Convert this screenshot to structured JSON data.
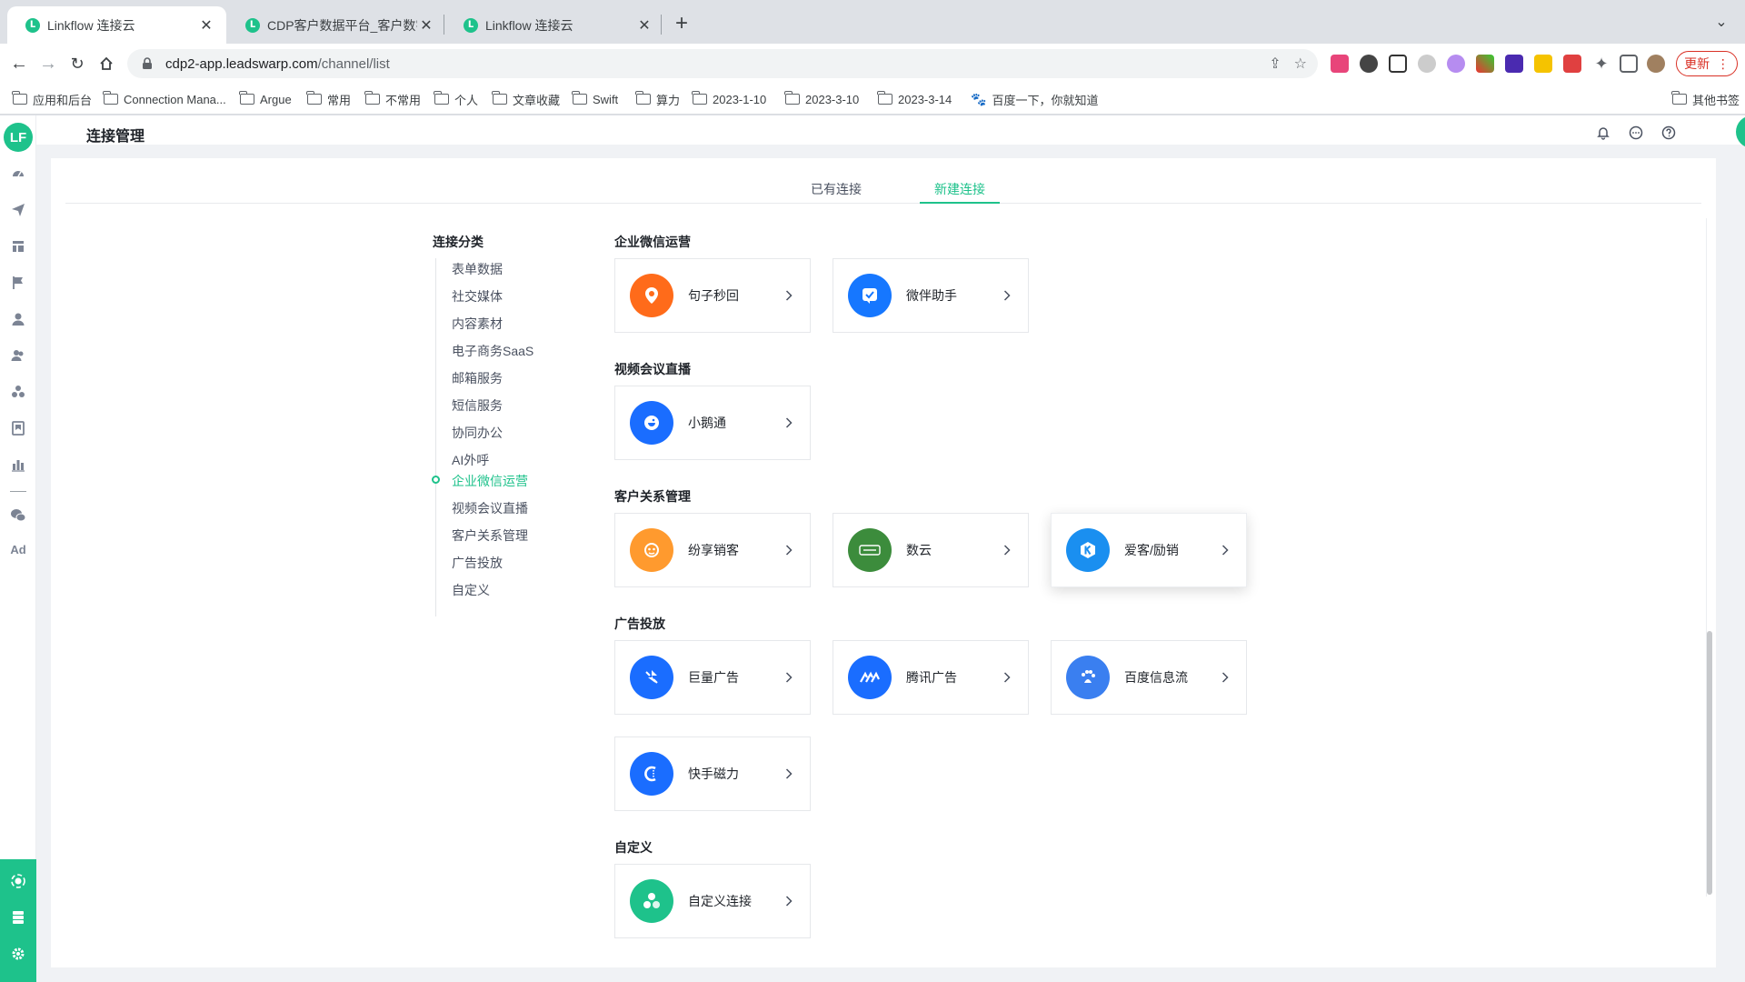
{
  "browser": {
    "tabs": [
      {
        "title": "Linkflow 连接云",
        "favicon": "linkflow-favicon"
      },
      {
        "title": "CDP客户数据平台_客户数字化全",
        "favicon": "linkflow-favicon"
      },
      {
        "title": "Linkflow 连接云",
        "favicon": "linkflow-favicon"
      }
    ],
    "url_host": "cdp2-app.leadswarp.com",
    "url_path": "/channel/list",
    "update_label": "更新",
    "bookmarks": [
      "应用和后台",
      "Connection Mana...",
      "Argue",
      "常用",
      "不常用",
      "个人",
      "文章收藏",
      "Swift",
      "算力",
      "2023-1-10",
      "2023-3-10",
      "2023-3-14",
      "百度一下，你就知道"
    ],
    "other_bookmarks": "其他书签"
  },
  "app": {
    "logo": "LF",
    "page_title": "连接管理",
    "sidebar_ad": "Ad",
    "tabs": [
      "已有连接",
      "新建连接"
    ],
    "active_tab": 1,
    "category_title": "连接分类",
    "categories": [
      "表单数据",
      "社交媒体",
      "内容素材",
      "电子商务SaaS",
      "邮箱服务",
      "短信服务",
      "协同办公",
      "AI外呼",
      "企业微信运营",
      "视频会议直播",
      "客户关系管理",
      "广告投放",
      "自定义"
    ],
    "active_category": 8,
    "sections": [
      {
        "title": "企业微信运营",
        "cards": [
          {
            "name": "句子秒回",
            "icon": "chat-pin-icon",
            "color": "#ff6b1a"
          },
          {
            "name": "微伴助手",
            "icon": "check-bubble-icon",
            "color": "#1677ff"
          }
        ]
      },
      {
        "title": "视频会议直播",
        "cards": [
          {
            "name": "小鹅通",
            "icon": "goose-icon",
            "color": "#1a6dff"
          }
        ]
      },
      {
        "title": "客户关系管理",
        "cards": [
          {
            "name": "纷享销客",
            "icon": "fxiaoke-icon",
            "color": "#ff9a2e"
          },
          {
            "name": "数云",
            "icon": "shuyun-icon",
            "color": "#3c8c3c"
          },
          {
            "name": "爱客/励销",
            "icon": "k-icon",
            "color": "#1a8ff0"
          }
        ]
      },
      {
        "title": "广告投放",
        "cards": [
          {
            "name": "巨量广告",
            "icon": "oceanengine-icon",
            "color": "#1a6dff"
          },
          {
            "name": "腾讯广告",
            "icon": "tencent-ads-icon",
            "color": "#1a6dff"
          },
          {
            "name": "百度信息流",
            "icon": "baidu-paw-icon",
            "color": "#3a7ff0"
          },
          {
            "name": "快手磁力",
            "icon": "kuaishou-icon",
            "color": "#1a6dff"
          }
        ]
      },
      {
        "title": "自定义",
        "cards": [
          {
            "name": "自定义连接",
            "icon": "custom-connect-icon",
            "color": "#1ec28b"
          }
        ]
      }
    ]
  }
}
